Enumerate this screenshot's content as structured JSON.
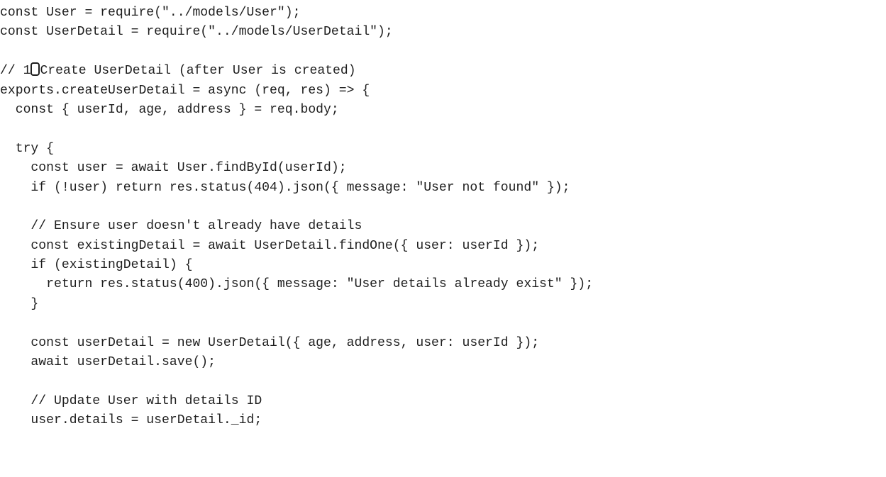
{
  "code": {
    "line_1": "const User = require(\"../models/User\");",
    "line_2": "const UserDetail = require(\"../models/UserDetail\");",
    "line_3": "",
    "line_4_prefix": "// 1",
    "line_4_glyph": "",
    "line_4_suffix": "Create UserDetail (after User is created)",
    "line_5": "exports.createUserDetail = async (req, res) => {",
    "line_6": "  const { userId, age, address } = req.body;",
    "line_7": "",
    "line_8": "  try {",
    "line_9": "    const user = await User.findById(userId);",
    "line_10": "    if (!user) return res.status(404).json({ message: \"User not found\" });",
    "line_11": "",
    "line_12": "    // Ensure user doesn't already have details",
    "line_13": "    const existingDetail = await UserDetail.findOne({ user: userId });",
    "line_14": "    if (existingDetail) {",
    "line_15": "      return res.status(400).json({ message: \"User details already exist\" });",
    "line_16": "    }",
    "line_17": "",
    "line_18": "    const userDetail = new UserDetail({ age, address, user: userId });",
    "line_19": "    await userDetail.save();",
    "line_20": "",
    "line_21": "    // Update User with details ID",
    "line_22": "    user.details = userDetail._id;"
  },
  "colors": {
    "text": "#1e1e1e",
    "background": "#ffffff"
  }
}
